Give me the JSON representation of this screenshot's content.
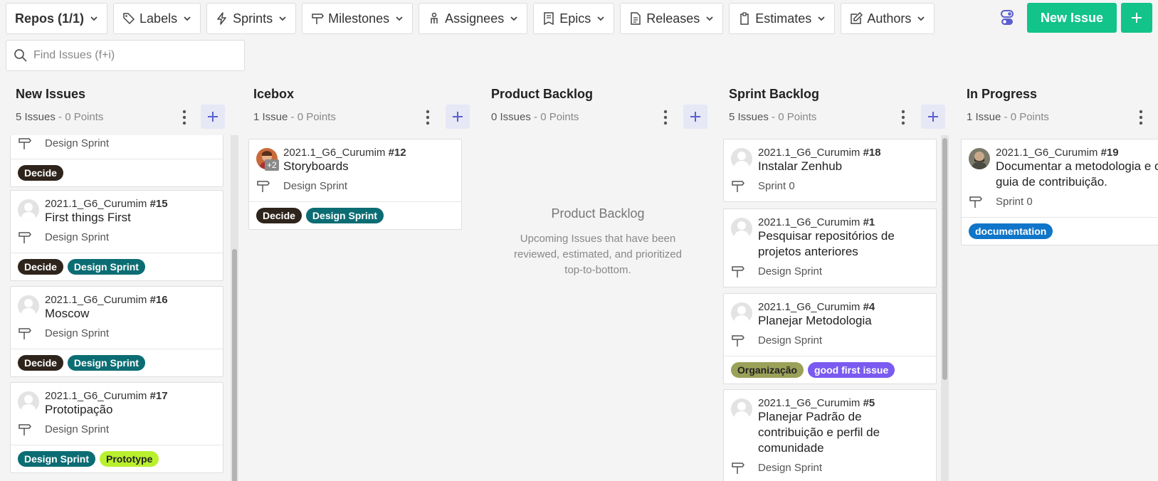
{
  "toolbar": {
    "repos": "Repos (1/1)",
    "labels": "Labels",
    "sprints": "Sprints",
    "milestones": "Milestones",
    "assignees": "Assignees",
    "epics": "Epics",
    "releases": "Releases",
    "estimates": "Estimates",
    "authors": "Authors",
    "new_issue": "New Issue"
  },
  "search": {
    "placeholder": "Find Issues (f+i)"
  },
  "colors": {
    "accent": "#12c38a",
    "decide": "#2e241c",
    "design_sprint": "#0b6d73",
    "prototype": "#b9f02e",
    "documentation": "#0f75c9",
    "organizacao": "#9aa159",
    "good_first_issue": "#7a5af0"
  },
  "columns": [
    {
      "title": "New Issues",
      "issues": "5 Issues",
      "points": " - 0 Points",
      "partial": {
        "milestone": "Design Sprint",
        "label": "Decide"
      },
      "cards": [
        {
          "repo": "2021.1_G6_Curumim",
          "num": "#15",
          "title": "First things First",
          "milestone": "Design Sprint",
          "labels": [
            "Decide",
            "Design Sprint"
          ]
        },
        {
          "repo": "2021.1_G6_Curumim",
          "num": "#16",
          "title": "Moscow",
          "milestone": "Design Sprint",
          "labels": [
            "Decide",
            "Design Sprint"
          ]
        },
        {
          "repo": "2021.1_G6_Curumim",
          "num": "#17",
          "title": "Prototipação",
          "milestone": "Design Sprint",
          "labels": [
            "Design Sprint",
            "Prototype"
          ]
        }
      ]
    },
    {
      "title": "Icebox",
      "issues": "1 Issue",
      "points": " - 0 Points",
      "cards": [
        {
          "repo": "2021.1_G6_Curumim",
          "num": "#12",
          "title": "Storyboards",
          "milestone": "Design Sprint",
          "extra": "+2",
          "labels": [
            "Decide",
            "Design Sprint"
          ]
        }
      ]
    },
    {
      "title": "Product Backlog",
      "issues": "0 Issues",
      "points": " - 0 Points",
      "empty_title": "Product Backlog",
      "empty_desc": "Upcoming Issues that have been reviewed, estimated, and prioritized top-to-bottom."
    },
    {
      "title": "Sprint Backlog",
      "issues": "5 Issues",
      "points": " - 0 Points",
      "cards": [
        {
          "repo": "2021.1_G6_Curumim",
          "num": "#18",
          "title": "Instalar Zenhub",
          "milestone": "Sprint 0"
        },
        {
          "repo": "2021.1_G6_Curumim",
          "num": "#1",
          "title": "Pesquisar repositórios de projetos anteriores",
          "milestone": "Design Sprint"
        },
        {
          "repo": "2021.1_G6_Curumim",
          "num": "#4",
          "title": "Planejar Metodologia",
          "milestone": "Design Sprint",
          "labels": [
            "Organização",
            "good first issue"
          ]
        },
        {
          "repo": "2021.1_G6_Curumim",
          "num": "#5",
          "title": "Planejar Padrão de contribuição e perfil de comunidade",
          "milestone": "Design Sprint"
        }
      ]
    },
    {
      "title": "In Progress",
      "issues": "1 Issue",
      "points": " - 0 Points",
      "cards": [
        {
          "repo": "2021.1_G6_Curumim",
          "num": "#19",
          "title": "Documentar a metodologia e o guia de contribuição.",
          "milestone": "Sprint 0",
          "labels": [
            "documentation"
          ]
        }
      ]
    }
  ]
}
